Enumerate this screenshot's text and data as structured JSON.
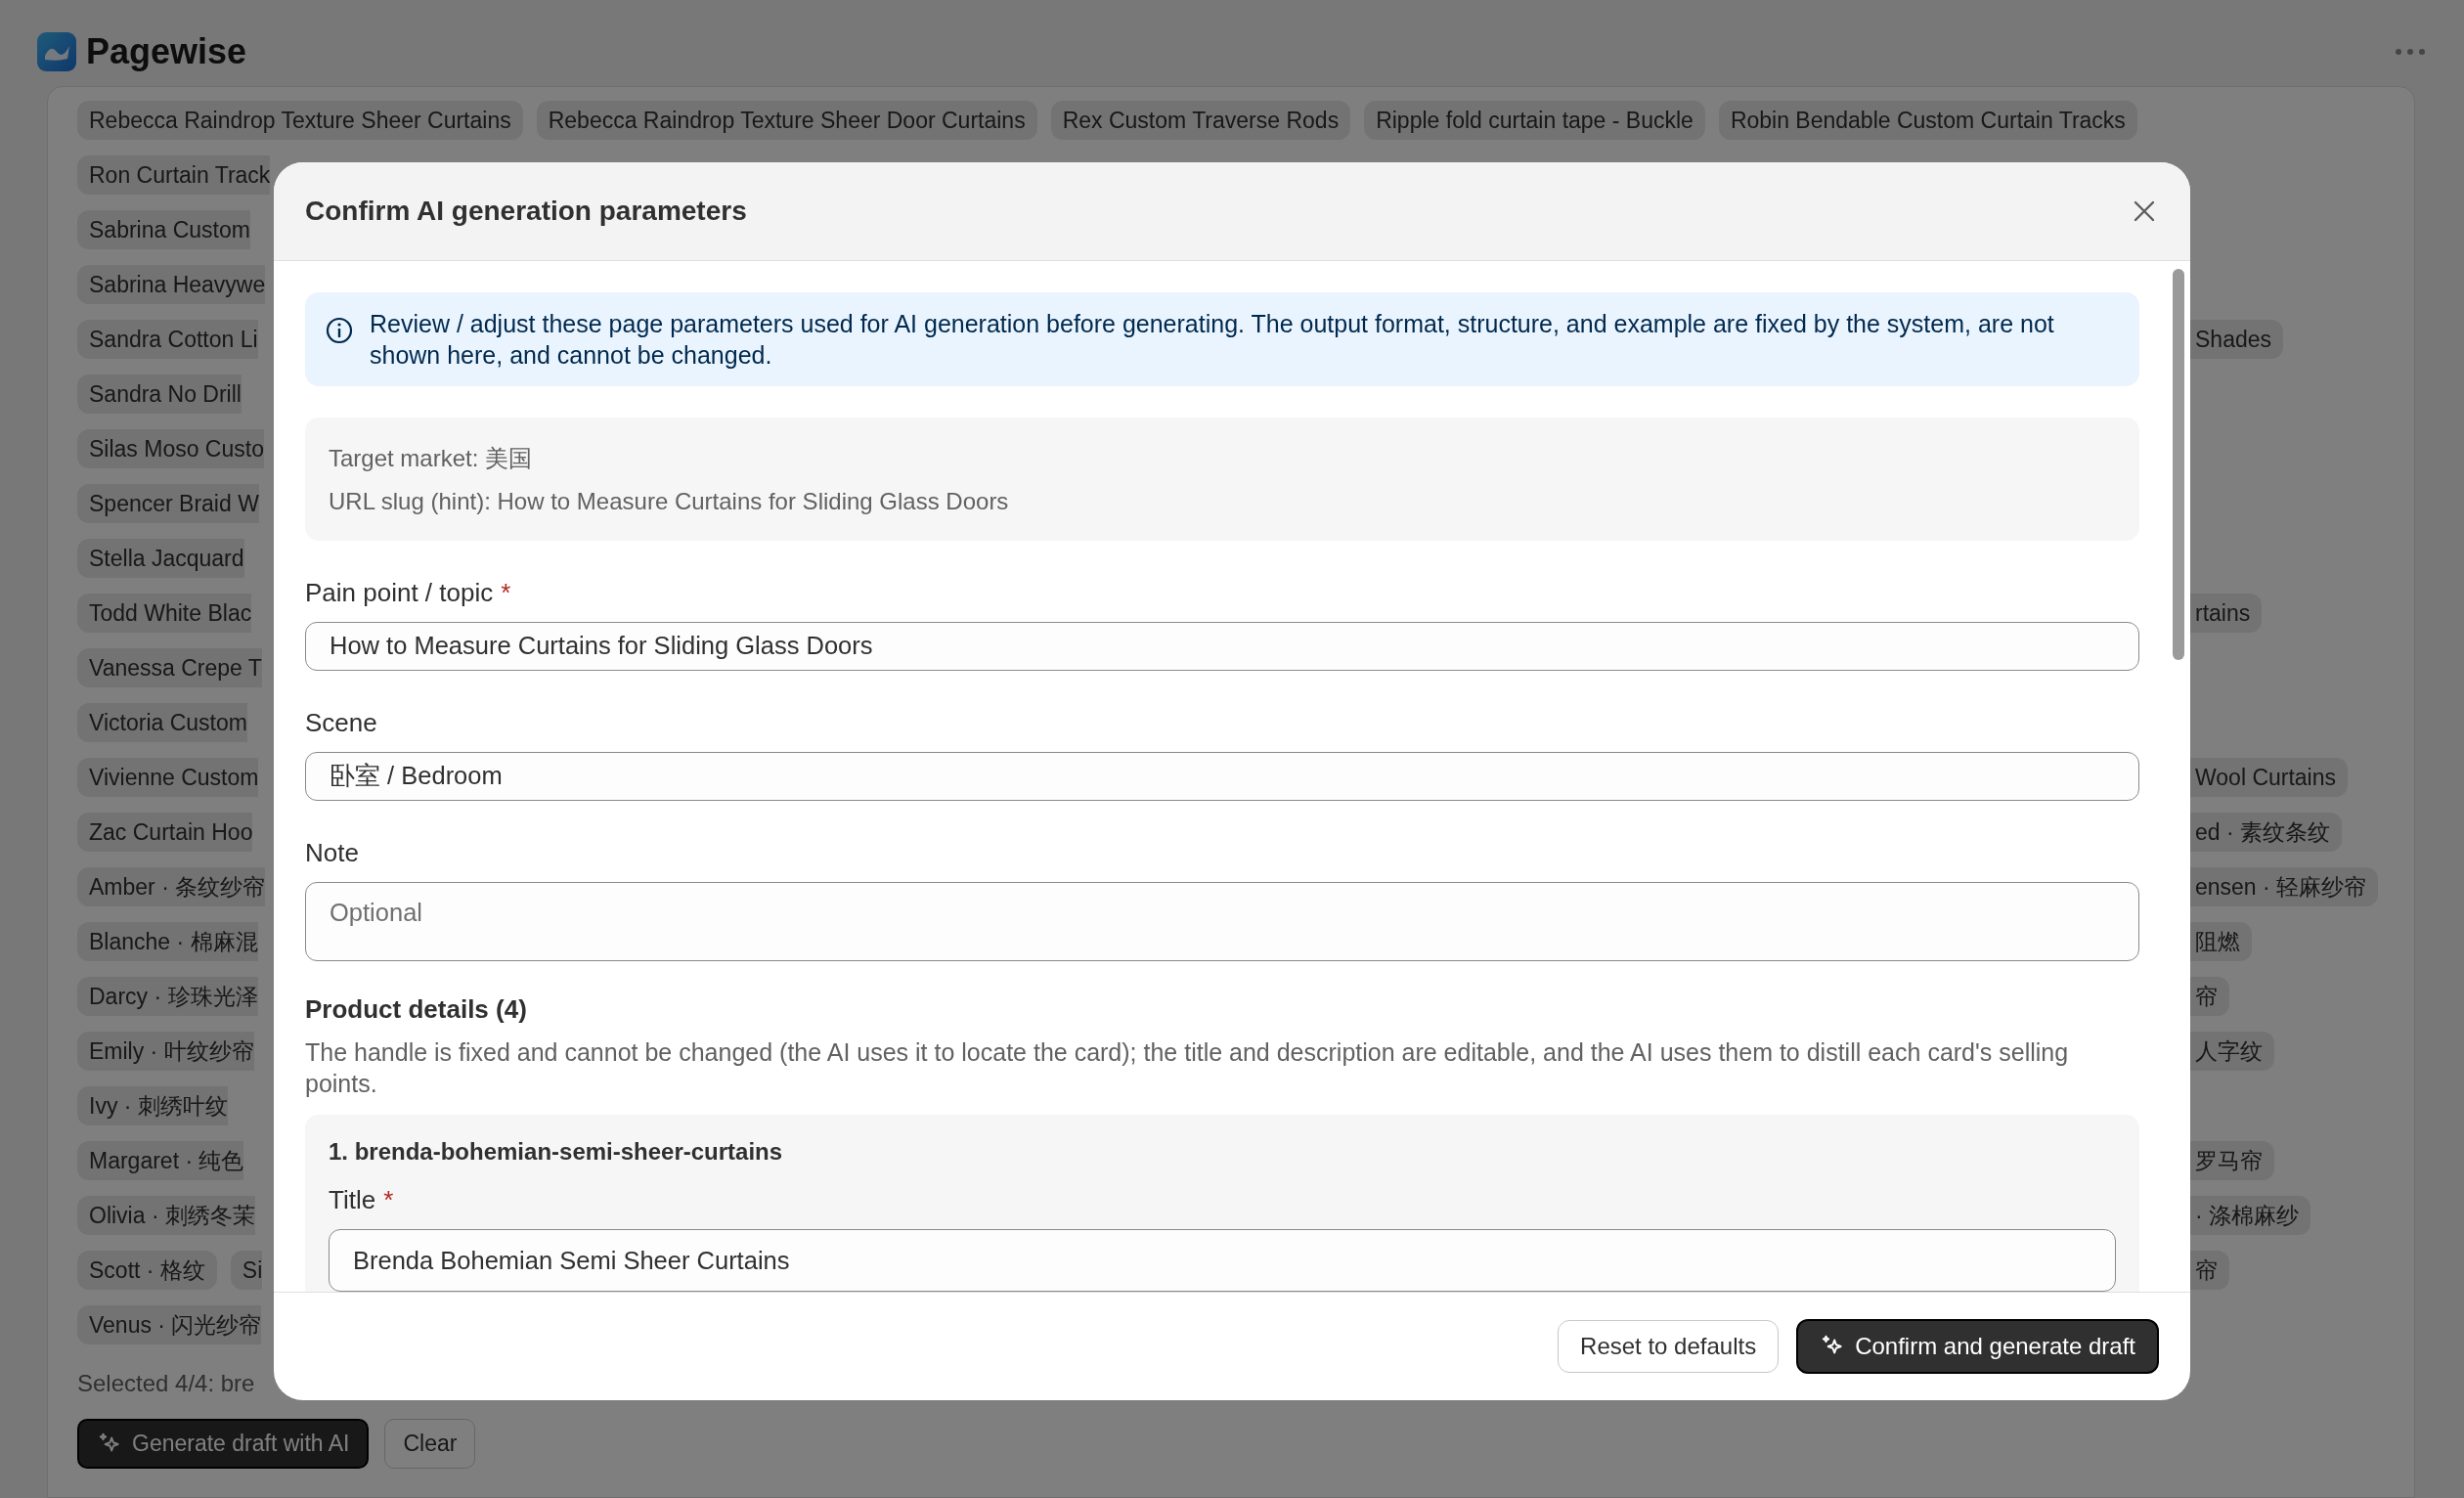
{
  "app": {
    "title": "Pagewise"
  },
  "background": {
    "chip_rows": [
      {
        "left": [
          "Rebecca Raindrop Texture Sheer Curtains",
          "Rebecca Raindrop Texture Sheer Door Curtains",
          "Rex Custom Traverse Rods",
          "Ripple fold curtain tape - Buckle",
          "Robin Bendable Custom Curtain Tracks"
        ]
      },
      {
        "left": [
          "Ron Curtain Track"
        ]
      },
      {
        "left": [
          "Sabrina Custom"
        ]
      },
      {
        "left": [
          "Sabrina Heavywe"
        ]
      },
      {
        "left": [
          "Sandra Cotton Li"
        ],
        "right": "Shades"
      },
      {
        "left": [
          "Sandra No Drill"
        ]
      },
      {
        "left": [
          "Silas Moso Custo"
        ]
      },
      {
        "left": [
          "Spencer Braid W"
        ]
      },
      {
        "left": [
          "Stella Jacquard"
        ]
      },
      {
        "left": [
          "Todd White Blac"
        ],
        "right": "rtains"
      },
      {
        "left": [
          "Vanessa Crepe T"
        ]
      },
      {
        "left": [
          "Victoria Custom"
        ]
      },
      {
        "left": [
          "Vivienne Custom"
        ],
        "right": "Wool Curtains"
      },
      {
        "left": [
          "Zac Curtain Hoo"
        ],
        "right": "ed · 素纹条纹"
      },
      {
        "left": [
          "Amber · 条纹纱帘"
        ],
        "right": "ensen · 轻麻纱帘"
      },
      {
        "left": [
          "Blanche · 棉麻混"
        ],
        "right": "阻燃"
      },
      {
        "left": [
          "Darcy · 珍珠光泽"
        ],
        "right": "帘"
      },
      {
        "left": [
          "Emily · 叶纹纱帘"
        ],
        "right": "人字纹"
      },
      {
        "left": [
          "Ivy · 刺绣叶纹"
        ]
      },
      {
        "left": [
          "Margaret · 纯色"
        ],
        "right": "罗马帘"
      },
      {
        "left": [
          "Olivia · 刺绣冬茉"
        ],
        "right": "· 涤棉麻纱"
      },
      {
        "left": [
          "Scott · 格纹",
          "Si"
        ],
        "right": "帘"
      },
      {
        "left": [
          "Venus · 闪光纱帘"
        ]
      }
    ],
    "selection_summary": "Selected 4/4: bre",
    "buttons": [
      {
        "label": "Generate draft with AI",
        "kind": "primary"
      },
      {
        "label": "Clear",
        "kind": "secondary"
      }
    ]
  },
  "dialog": {
    "title": "Confirm AI generation parameters",
    "notice": "Review / adjust these page parameters used for AI generation before generating. The output format, structure, and example are fixed by the system, are not shown here, and cannot be changed.",
    "info_lines": [
      "Target market: 美国",
      "URL slug (hint): How to Measure Curtains for Sliding Glass Doors"
    ],
    "fields": [
      {
        "label": "Pain point / topic",
        "required_mark": "*",
        "kind": "input",
        "value": "How to Measure Curtains for Sliding Glass Doors"
      },
      {
        "label": "Scene",
        "kind": "input",
        "value": "卧室 / Bedroom"
      },
      {
        "label": "Note",
        "kind": "textarea",
        "placeholder": "Optional"
      }
    ],
    "product_details": {
      "heading": "Product details (4)",
      "description": "The handle is fixed and cannot be changed (the AI uses it to locate the card); the title and description are editable, and the AI uses them to distill each card's selling points.",
      "cards": [
        {
          "handle": "1. brenda-bohemian-semi-sheer-curtains",
          "title_label": "Title",
          "title_required_mark": "*",
          "title_value": "Brenda Bohemian Semi Sheer Curtains"
        }
      ]
    },
    "buttons": [
      {
        "label": "Reset to defaults",
        "kind": "secondary"
      },
      {
        "label": "Confirm and generate draft",
        "kind": "primary"
      }
    ]
  }
}
